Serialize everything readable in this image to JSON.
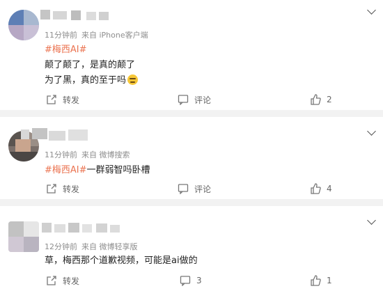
{
  "posts": [
    {
      "time": "11分钟前",
      "source": "来自 iPhone客户端",
      "hashtag": "#梅西AI#",
      "lines": [
        "颠了颠了，是真的颠了",
        "为了黑，真的至于吗"
      ],
      "repost_label": "转发",
      "comment_label": "评论",
      "like_count": "2"
    },
    {
      "time": "11分钟前",
      "source": "来自 微博搜索",
      "hashtag": "#梅西AI#",
      "text": "一群弱智吗卧槽",
      "repost_label": "转发",
      "comment_label": "评论",
      "like_count": "4"
    },
    {
      "time": "12分钟前",
      "source": "来自 微博轻享版",
      "text": "草，梅西那个道歉视频，可能是ai做的",
      "repost_label": "转发",
      "comment_count": "3",
      "like_count": "1"
    }
  ],
  "colors": {
    "hashtag": "#eb7350",
    "meta": "#8e8e8e",
    "divider": "#f2f2f2"
  }
}
